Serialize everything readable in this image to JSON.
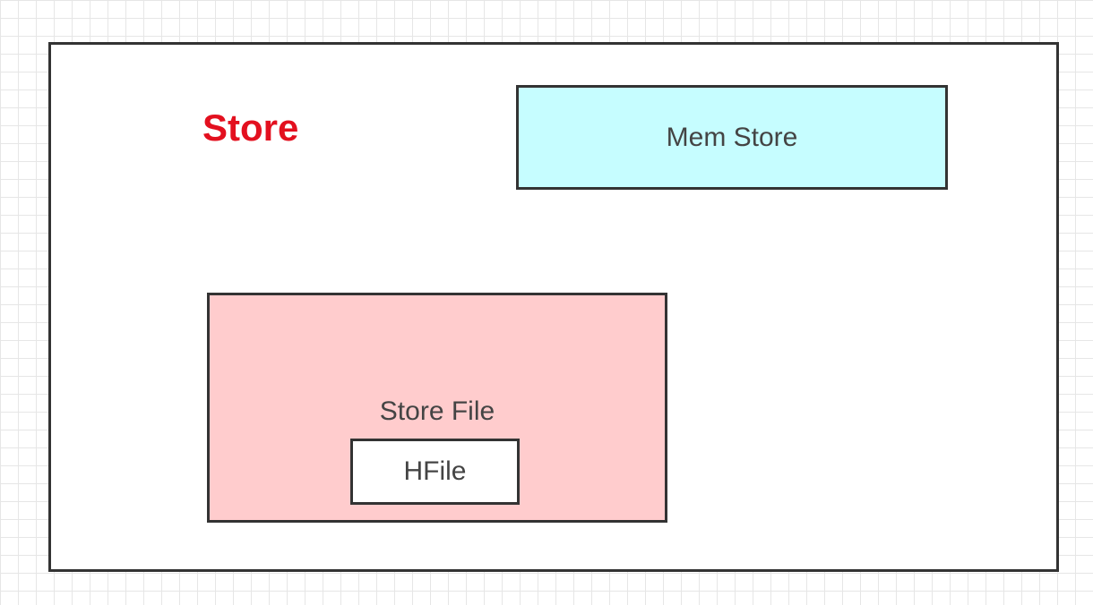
{
  "diagram": {
    "store": {
      "title": "Store",
      "title_color": "#e3101f"
    },
    "memstore": {
      "label": "Mem Store",
      "fill_color": "#c6fdff"
    },
    "storefile": {
      "label": "Store File",
      "fill_color": "#ffcccd"
    },
    "hfile": {
      "label": "HFile",
      "fill_color": "#ffffff"
    }
  }
}
